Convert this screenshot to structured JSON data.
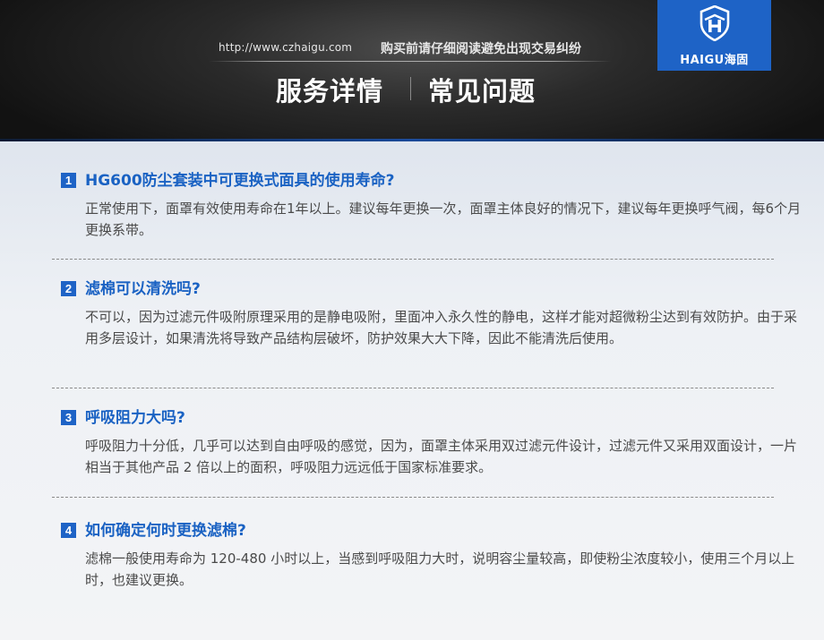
{
  "header": {
    "url": "http://www.czhaigu.com",
    "notice": "购买前请仔细阅读避免出现交易纠纷",
    "tabs": [
      {
        "label": "服务详情"
      },
      {
        "label": "常见问题"
      }
    ],
    "logo": {
      "text": "HAIGU海固",
      "icon": "shield-h-logo-icon",
      "color": "#1e63c6"
    }
  },
  "faq": [
    {
      "number": "1",
      "question": "HG600防尘套装中可更换式面具的使用寿命?",
      "answer": "正常使用下，面罩有效使用寿命在1年以上。建议每年更换一次，面罩主体良好的情况下，建议每年更换呼气阀，每6个月更换系带。"
    },
    {
      "number": "2",
      "question": "滤棉可以清洗吗?",
      "answer": "不可以，因为过滤元件吸附原理采用的是静电吸附，里面冲入永久性的静电，这样才能对超微粉尘达到有效防护。由于采用多层设计，如果清洗将导致产品结构层破坏，防护效果大大下降，因此不能清洗后使用。"
    },
    {
      "number": "3",
      "question": "呼吸阻力大吗?",
      "answer": "呼吸阻力十分低，几乎可以达到自由呼吸的感觉，因为，面罩主体采用双过滤元件设计，过滤元件又采用双面设计，一片相当于其他产品 2 倍以上的面积，呼吸阻力远远低于国家标准要求。"
    },
    {
      "number": "4",
      "question": "如何确定何时更换滤棉?",
      "answer": "滤棉一般使用寿命为 120-480 小时以上，当感到呼吸阻力大时，说明容尘量较高，即使粉尘浓度较小，使用三个月以上时，也建议更换。"
    }
  ],
  "colors": {
    "accent": "#1e63c6",
    "question_text": "#1a62c3",
    "answer_text": "#4a4a4a"
  }
}
